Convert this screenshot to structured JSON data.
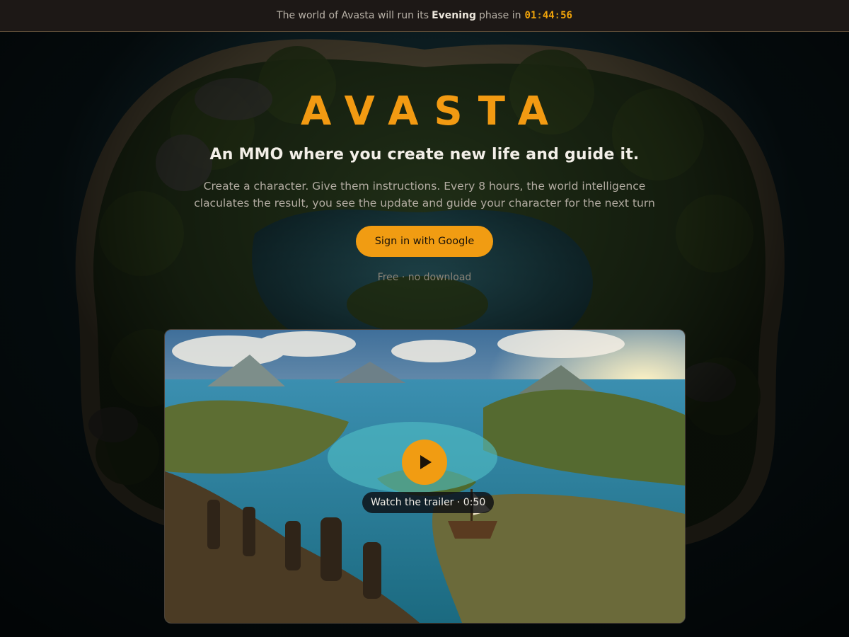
{
  "topbar": {
    "prefix": "The world of Avasta will run its",
    "phase": "Evening",
    "middle": "phase in",
    "timer": {
      "hours": "01",
      "minutes": "44",
      "seconds": "56",
      "separator": ":"
    }
  },
  "hero": {
    "logo": "AVASTA",
    "tagline": "An MMO where you create new life and guide it.",
    "description_line1": "Create a character. Give them instructions. Every 8 hours, the world intelligence",
    "description_line2": "claculates the result, you see the update and guide your character for the next turn",
    "cta_label": "Sign in with Google",
    "subnote": "Free · no download"
  },
  "trailer": {
    "label": "Watch the trailer · 0:50",
    "play_icon": "play-icon"
  },
  "colors": {
    "accent": "#f19c12",
    "topbar_bg": "#1d1816",
    "page_bg": "#0b1418"
  }
}
